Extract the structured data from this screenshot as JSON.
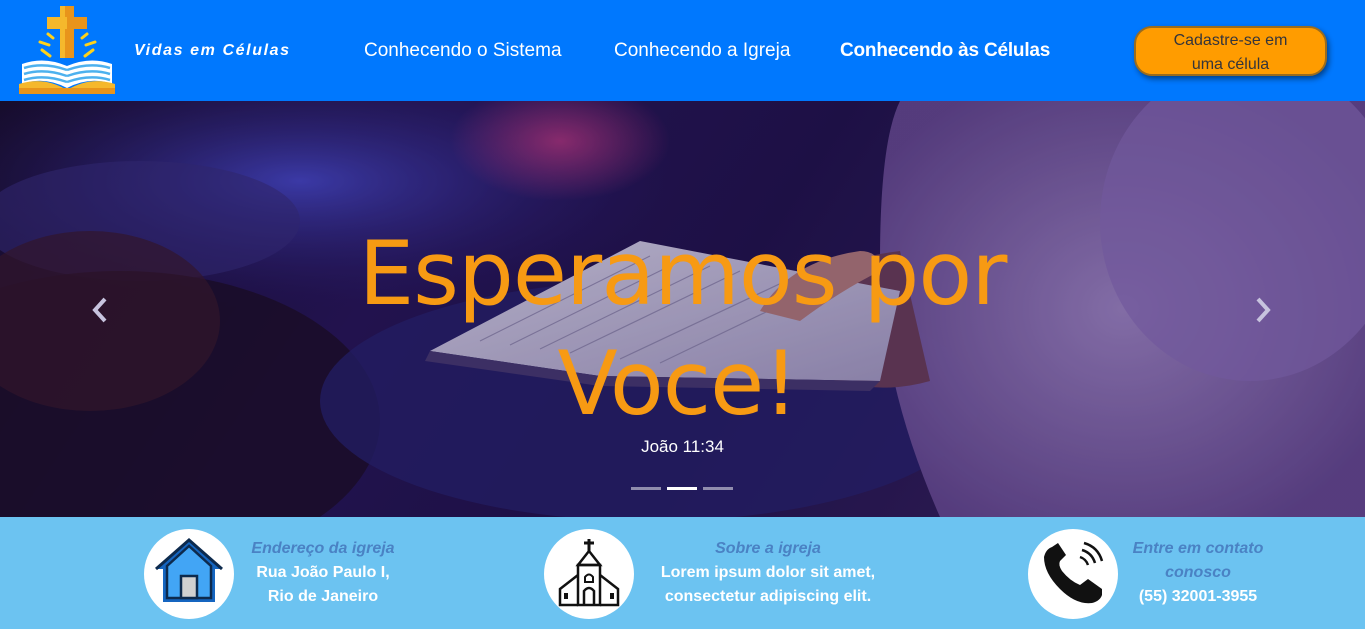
{
  "header": {
    "brand": "Vidas em Células",
    "nav": [
      {
        "label": "Conhecendo o Sistema",
        "active": false
      },
      {
        "label": "Conhecendo a Igreja",
        "active": false
      },
      {
        "label": "Conhecendo às Células",
        "active": true
      }
    ],
    "cta": {
      "line1": "Cadastre-se em",
      "line2": "uma célula"
    }
  },
  "hero": {
    "title_line1": "Esperamos por",
    "title_line2": "Voce!",
    "caption": "João 11:34",
    "slides_count": 3,
    "active_slide": 2
  },
  "info": {
    "address": {
      "heading": "Endereço da igreja",
      "line1": "Rua João Paulo I,",
      "line2": "Rio de Janeiro",
      "icon": "house-icon"
    },
    "about": {
      "heading": "Sobre a igreja",
      "line1": "Lorem ipsum dolor sit amet,",
      "line2": "consectetur adipiscing elit.",
      "icon": "church-icon"
    },
    "contact": {
      "heading_line1": "Entre em contato",
      "heading_line2": "conosco",
      "phone": "(55) 32001-3955",
      "icon": "phone-icon"
    }
  },
  "colors": {
    "header_bg": "#0078fe",
    "cta_bg": "#ff9c00",
    "hero_title": "#f79a13",
    "info_bg": "#6cc3f1",
    "info_heading": "#4a82c4"
  }
}
